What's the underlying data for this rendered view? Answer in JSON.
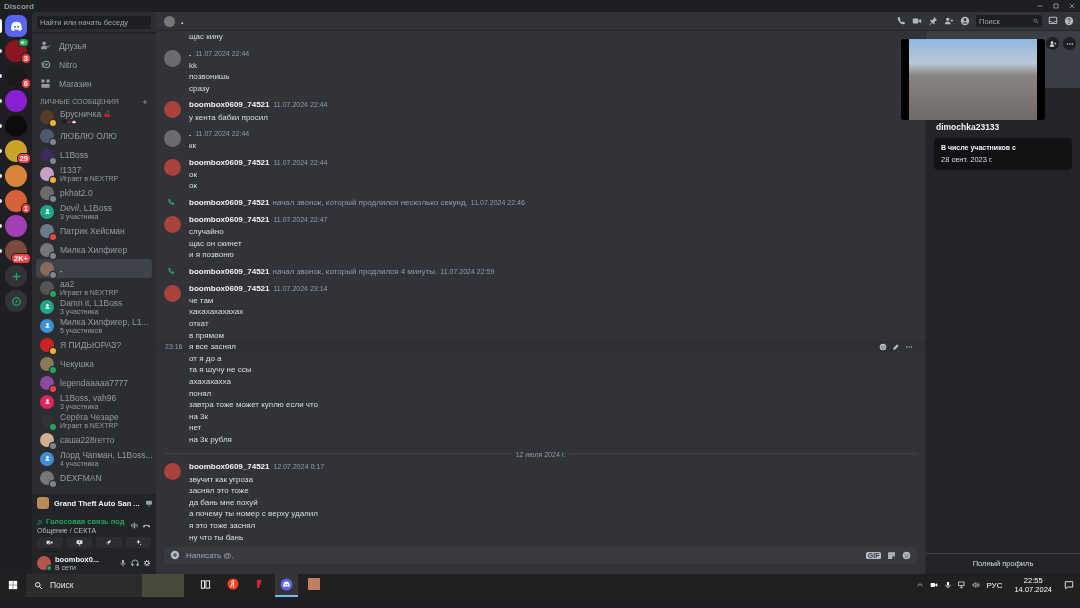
{
  "window": {
    "title": "Discord"
  },
  "servers": [
    {
      "unread": true,
      "badge": "3",
      "speaking": true
    },
    {
      "unread": true,
      "badge": "6",
      "speaking": false
    },
    {
      "unread": true,
      "speaking": false
    },
    {
      "unread": true,
      "speaking": false
    },
    {
      "unread": true,
      "badge": "29",
      "speaking": false
    },
    {
      "unread": true,
      "speaking": false
    },
    {
      "unread": true,
      "badge": "1",
      "speaking": false
    },
    {
      "unread": true,
      "speaking": false
    },
    {
      "unread": true,
      "badge": "2K+",
      "speaking": false
    }
  ],
  "sidebar": {
    "search_placeholder": "Найти или начать беседу",
    "nav": [
      {
        "kind": "friends",
        "label": "Друзья"
      },
      {
        "kind": "nitro",
        "label": "Nitro"
      },
      {
        "kind": "shop",
        "label": "Магазин"
      }
    ],
    "dm_header": "ЛИЧНЫЕ СООБЩЕНИЯ",
    "dms": [
      {
        "kind": "user",
        "name": "Брусничка",
        "color": "#f0b232",
        "emoji_status": true,
        "selected": false
      },
      {
        "kind": "user",
        "name": "ЛЮБЛЮ ОЛЮ",
        "color": "#80848e",
        "emoji_status": false,
        "selected": false
      },
      {
        "kind": "user",
        "name": "L1Boss",
        "color": "#80848e",
        "emoji_status": false,
        "selected": false
      },
      {
        "kind": "user",
        "name": "!1337",
        "subtitle": "Играет в NEXTRP",
        "color": "#f0b232",
        "emoji_status": false,
        "selected": false
      },
      {
        "kind": "user",
        "name": "pkhat2.0",
        "color": "#80848e",
        "emoji_status": false,
        "selected": false
      },
      {
        "kind": "group",
        "name": "*Devil*, L1Boss",
        "subtitle": "3 участника",
        "color": "#1fa688",
        "selected": false
      },
      {
        "kind": "user",
        "name": "Патрик Хейсман",
        "color": "#f23f43",
        "emoji_status": false,
        "selected": false
      },
      {
        "kind": "user",
        "name": "Милка Хилфигер",
        "color": "#80848e",
        "emoji_status": false,
        "selected": false
      },
      {
        "kind": "user",
        "name": ".",
        "color": "#80848e",
        "emoji_status": false,
        "selected": true
      },
      {
        "kind": "user",
        "name": "aa2",
        "subtitle": "Играет в NEXTRP",
        "color": "#23a55a",
        "emoji_status": false,
        "selected": false
      },
      {
        "kind": "group",
        "name": "Damn it, L1Boss",
        "subtitle": "3 участника",
        "color": "#1fa688",
        "selected": false
      },
      {
        "kind": "group",
        "name": "Милка Хилфигер, L1...",
        "subtitle": "5 участников",
        "color": "#3d8fd6",
        "selected": false
      },
      {
        "kind": "user",
        "name": "Я ПИДЬЮРАЗ?",
        "color": "#f0b232",
        "emoji_status": false,
        "selected": false
      },
      {
        "kind": "user",
        "name": "Чекушка",
        "color": "#23a55a",
        "emoji_status": false,
        "selected": false
      },
      {
        "kind": "user",
        "name": "legendaaaaa7777",
        "color": "#f23f43",
        "emoji_status": false,
        "selected": false
      },
      {
        "kind": "group",
        "name": "L1Boss, vah96",
        "subtitle": "3 участника",
        "color": "#e0245e",
        "selected": false
      },
      {
        "kind": "user",
        "name": "Серёга Чезаре",
        "subtitle": "Играет в NEXTRP",
        "color": "#23a55a",
        "emoji_status": false,
        "selected": false
      },
      {
        "kind": "user",
        "name": "саша228гетто",
        "color": "#80848e",
        "emoji_status": false,
        "selected": false
      },
      {
        "kind": "group",
        "name": "Лорд Чапман, L1Boss...",
        "subtitle": "4 участника",
        "color": "#3d8fd6",
        "selected": false
      },
      {
        "kind": "user",
        "name": "DEXFMAN",
        "color": "#80848e",
        "emoji_status": false,
        "selected": false
      }
    ],
    "activity": {
      "game": "Grand Theft Auto San ..."
    },
    "voice": {
      "status": "Голосовая связь под",
      "channel": "Общение / СЕКТА"
    },
    "user": {
      "name": "boombox0...",
      "status": "В сети"
    }
  },
  "chat": {
    "header": {
      "name": "."
    },
    "search_placeholder": "Поиск",
    "messages": [
      {
        "kind": "tail",
        "lines": [
          {
            "text": "щас кину"
          }
        ]
      },
      {
        "kind": "group",
        "author": ".",
        "time": "11.07.2024 22:44",
        "lines": [
          {
            "text": "kk"
          },
          {
            "text": "позвонишь"
          },
          {
            "text": "сразу"
          }
        ]
      },
      {
        "kind": "group",
        "author": "boombox0609_74521",
        "time": "11.07.2024 22:44",
        "lines": [
          {
            "text": "у кента бабки просил"
          }
        ]
      },
      {
        "kind": "group",
        "author": ".",
        "time": "11.07.2024 22:44",
        "lines": [
          {
            "text": "кк"
          }
        ]
      },
      {
        "kind": "group",
        "author": "boombox0609_74521",
        "time": "11.07.2024 22:44",
        "lines": [
          {
            "text": "ок"
          },
          {
            "text": "ок"
          }
        ]
      },
      {
        "kind": "call",
        "author": "boombox0609_74521",
        "text": "начал звонок, который продлился несколько секунд.",
        "time": "11.07.2024 22:46"
      },
      {
        "kind": "group",
        "author": "boombox0609_74521",
        "time": "11.07.2024 22:47",
        "lines": [
          {
            "text": "случайно"
          },
          {
            "text": "щас он скинет"
          },
          {
            "text": "и я позвоню"
          }
        ]
      },
      {
        "kind": "call",
        "author": "boombox0609_74521",
        "text": "начал звонок, который продлился 4 минуты.",
        "time": "11.07.2024 22:59"
      },
      {
        "kind": "group",
        "author": "boombox0609_74521",
        "time": "11.07.2024 23:14",
        "lines": [
          {
            "text": "че там"
          },
          {
            "text": "хахахахахахах"
          },
          {
            "text": "откат"
          },
          {
            "text": "в прямом"
          },
          {
            "text": "я все заснял",
            "time": "23:16"
          },
          {
            "text": "от я до а"
          },
          {
            "text": "та я шучу не ссы"
          },
          {
            "text": "ахахахахха"
          },
          {
            "text": "понял"
          },
          {
            "text": "завтра тоже может куплю если что"
          },
          {
            "text": "на 3к"
          },
          {
            "text": "нет"
          },
          {
            "text": "на 3к рубля"
          }
        ]
      },
      {
        "kind": "divider",
        "label": "12 июля 2024 г."
      },
      {
        "kind": "group",
        "author": "boombox0609_74521",
        "time": "12.07.2024 0:17",
        "lines": [
          {
            "text": "звучит как угроза"
          },
          {
            "text": "заснял это тоже"
          },
          {
            "text": "да бань мне похуй"
          },
          {
            "text": "а почему ты номер с верху удалил"
          },
          {
            "text": "я это тоже заснял"
          },
          {
            "text": "ну что ты бань"
          }
        ]
      }
    ],
    "composer": {
      "placeholder": "Написать @.",
      "gif_label": "GIF"
    }
  },
  "profile": {
    "username": "dimochka23133",
    "member_since_label": "В числе участников с",
    "member_since": "28 сент. 2023 г.",
    "full_profile": "Полный профиль"
  },
  "taskbar": {
    "search_placeholder": "Поиск",
    "apps": [
      {
        "kind": "taskview",
        "selected": false
      },
      {
        "kind": "yandex",
        "selected": false
      },
      {
        "kind": "red",
        "selected": false
      },
      {
        "kind": "discord",
        "selected": true
      },
      {
        "kind": "photo",
        "selected": false
      }
    ],
    "language": "РУС",
    "time": "22:55",
    "date": "14.07.2024"
  }
}
